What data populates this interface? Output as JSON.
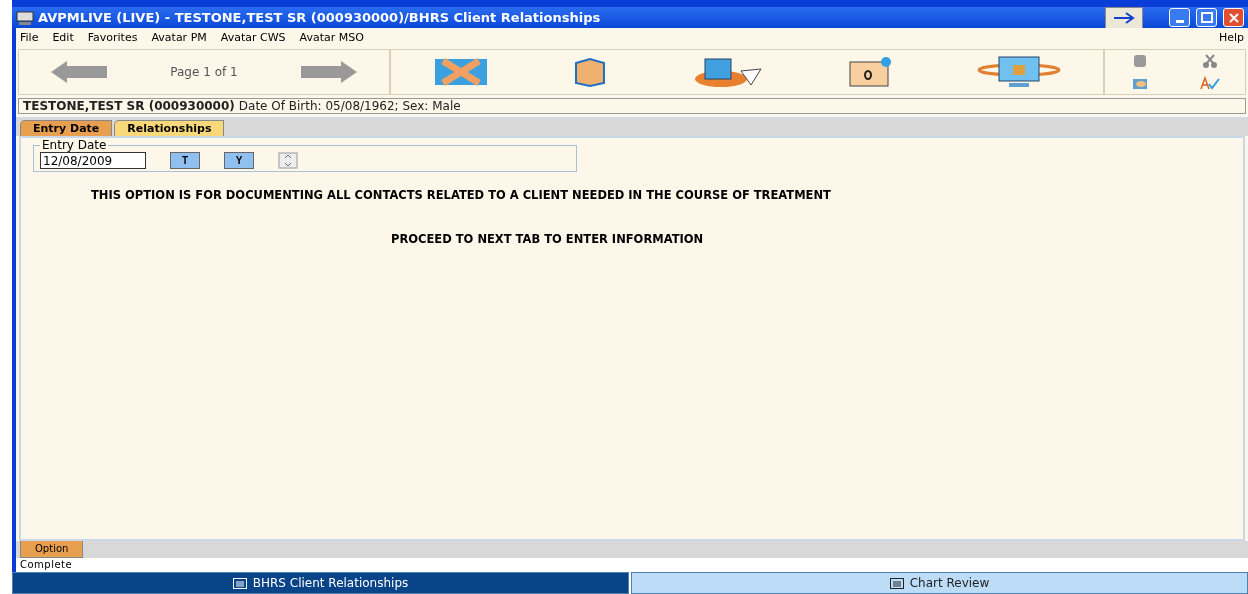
{
  "window": {
    "title": "AVPMLIVE (LIVE) - TESTONE,TEST SR (000930000)/BHRS Client Relationships"
  },
  "menu": [
    {
      "label": "File"
    },
    {
      "label": "Edit"
    },
    {
      "label": "Favorites"
    },
    {
      "label": "Avatar PM"
    },
    {
      "label": "Avatar CWS"
    },
    {
      "label": "Avatar MSO"
    },
    {
      "label": "Help"
    }
  ],
  "toolbar": {
    "page": "Page 1 of 1"
  },
  "patient": {
    "name": "TESTONE,TEST SR (000930000)",
    "details": "Date Of Birth: 05/08/1962; Sex: Male"
  },
  "tabs": [
    {
      "label": "Entry Date",
      "selected": true
    },
    {
      "label": "Relationships",
      "selected": false
    }
  ],
  "entry_date": {
    "legend": "Entry Date",
    "value": "12/08/2009",
    "buttons": [
      "T",
      "Y"
    ]
  },
  "messages": [
    "THIS OPTION IS FOR DOCUMENTING ALL CONTACTS RELATED TO A CLIENT NEEDED IN THE COURSE OF TREATMENT",
    "PROCEED TO NEXT TAB TO ENTER INFORMATION"
  ],
  "bottom_tabs": [
    {
      "label": "Option",
      "selected": true
    }
  ],
  "status_bar": "Complete",
  "taskbar": [
    {
      "label": "BHRS Client Relationships",
      "selected": true
    },
    {
      "label": "Chart Review",
      "selected": false
    }
  ]
}
